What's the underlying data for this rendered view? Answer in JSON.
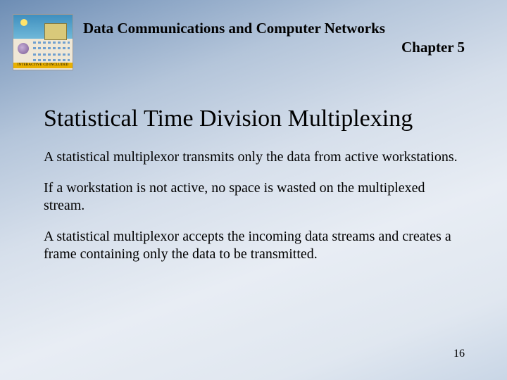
{
  "header": {
    "course_title": "Data Communications and Computer Networks",
    "chapter": "Chapter 5",
    "thumb_caption": "INTERACTIVE CD INCLUDED"
  },
  "slide": {
    "heading": "Statistical Time Division Multiplexing",
    "paragraphs": [
      "A statistical multiplexor transmits only the data from active workstations.",
      "If a workstation is not active, no space is wasted on the multiplexed stream.",
      "A statistical multiplexor accepts the incoming data streams and creates a frame containing only the data to be transmitted."
    ]
  },
  "page_number": "16"
}
